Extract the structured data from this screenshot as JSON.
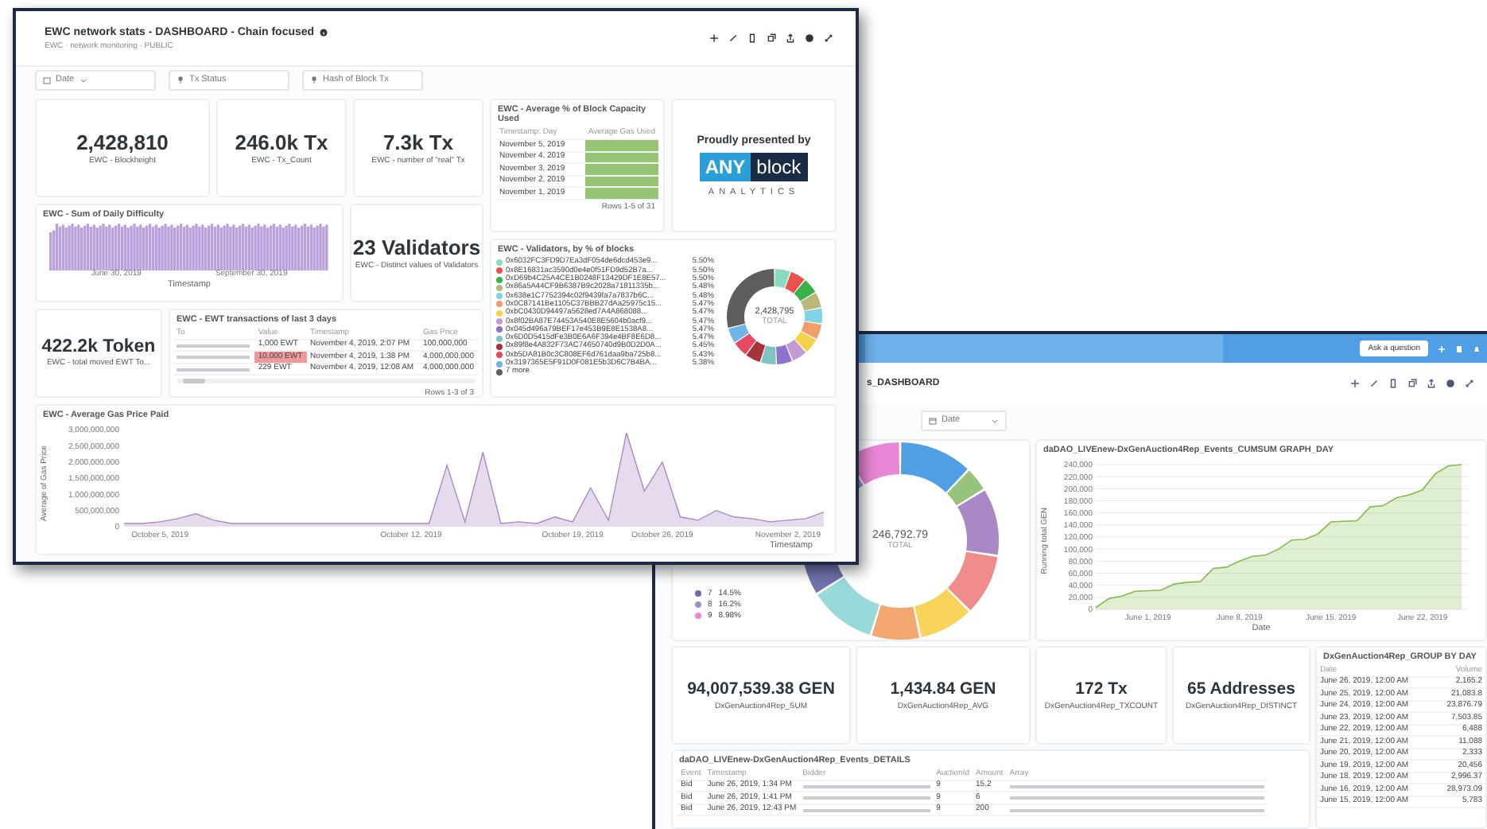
{
  "front_dashboard": {
    "title": "EWC network stats - DASHBOARD - Chain focused",
    "subtitle": "EWC · network monitoring · PUBLIC",
    "filters": [
      "Date",
      "Tx Status",
      "Hash of Block Tx"
    ],
    "stats": [
      {
        "value": "2,428,810",
        "label": "EWC - Blockheight"
      },
      {
        "value": "246.0k Tx",
        "label": "EWC - Tx_Count"
      },
      {
        "value": "7.3k Tx",
        "label": "EWC - number of \"real\" Tx"
      }
    ],
    "capacity_table": {
      "title": "EWC - Average % of Block Capacity Used",
      "columns": [
        "Timestamp: Day",
        "Average Gas Used"
      ],
      "rows": [
        "November 5, 2019",
        "November 4, 2019",
        "November 3, 2019",
        "November 2, 2019",
        "November 1, 2019"
      ],
      "footer": "Rows 1-5 of 31"
    },
    "promo": {
      "heading": "Proudly presented by",
      "logo_left": "ANY",
      "logo_right": "block",
      "logo_sub": "ANALYTICS"
    },
    "difficulty_chart": {
      "title": "EWC - Sum of Daily Difficulty",
      "x_labels": [
        "June 30, 2019",
        "September 30, 2019"
      ],
      "xlabel": "Timestamp"
    },
    "validators_stat": {
      "value": "23 Validators",
      "label": "EWC - Distinct values of Validators"
    },
    "validators_donut": {
      "title": "EWC - Validators, by % of blocks",
      "center_value": "2,428,795",
      "center_label": "TOTAL",
      "chart_data": {
        "type": "donut",
        "legend": "left",
        "categories": [
          "0x6032FC3FD9D7Ea3dF054de6dcd453e9...",
          "0x8E16831ac3590d0e4e0f51FD9d52B7a...",
          "0xD69b4C25A4CE1B0248F13429DF1E8E57...",
          "0x86a5A44CF9B6387B9c2028a71811335b...",
          "0x638e1C7752394c02f9439fa7a7837b6C...",
          "0x0C87141Be1105C37BBB27dAa25975c15...",
          "0xbC0430D94497a5628ed7A4A868088...",
          "0x8f02BA87E74453A540E8E5604b0acf9...",
          "0x045d496a79BEF17e453B9E8E1538A8...",
          "0x6D0D5415dFe3B0E6A6F394e4BF8E6D8...",
          "0x89f8e4A832F73AC74650740d9B0D2D0A...",
          "0xb5DA81B0c3C808EF6d761daa9ba725b8...",
          "0x3197365E5F91D0F081E5b3D6C7B4BA...",
          "7 more"
        ],
        "values": [
          5.5,
          5.5,
          5.5,
          5.48,
          5.48,
          5.47,
          5.47,
          5.47,
          5.47,
          5.47,
          5.45,
          5.43,
          5.38,
          28.93
        ],
        "value_labels": [
          "5.50%",
          "5.50%",
          "5.50%",
          "5.48%",
          "5.48%",
          "5.47%",
          "5.47%",
          "5.47%",
          "5.47%",
          "5.47%",
          "5.45%",
          "5.43%",
          "5.38%",
          null
        ],
        "colors": [
          "#88dbc2",
          "#e9524f",
          "#37b24d",
          "#b9b878",
          "#81d4e3",
          "#f29e6b",
          "#f5d24b",
          "#c49bd3",
          "#8f72c9",
          "#7fc4c0",
          "#a8323a",
          "#e54a62",
          "#6fb6e8",
          "#5e5e5e"
        ]
      }
    },
    "token_stat": {
      "value": "422.2k Token",
      "label": "EWC - total moved EWT To..."
    },
    "tx_table": {
      "title": "EWC - EWT transactions of last 3 days",
      "columns": [
        "To",
        "Value",
        "Timestamp",
        "Gas Price"
      ],
      "rows": [
        {
          "value": "1,000 EWT",
          "highlighted": false,
          "time": "November 4, 2019, 2:07 PM",
          "gas": "100,000,000"
        },
        {
          "value": "10,000 EWT",
          "highlighted": true,
          "time": "November 4, 2019, 1:38 PM",
          "gas": "4,000,000,000"
        },
        {
          "value": "229 EWT",
          "highlighted": false,
          "time": "November 4, 2019, 12:08 AM",
          "gas": "4,000,000,000"
        }
      ]
    },
    "gas_chart": {
      "title": "EWC - Average Gas Price Paid",
      "chart_data": {
        "type": "area",
        "xlabel": "Timestamp",
        "ylabel": "Average of Gas Price",
        "categories": [
          null,
          null,
          "October 5, 2019",
          null,
          null,
          null,
          null,
          null,
          null,
          null,
          null,
          null,
          null,
          null,
          null,
          null,
          "October 12, 2019",
          null,
          null,
          null,
          null,
          null,
          null,
          null,
          null,
          "October 19, 2019",
          null,
          null,
          null,
          null,
          "October 26, 2019",
          null,
          null,
          null,
          null,
          null,
          null,
          "November 2, 2019",
          null,
          null
        ],
        "series": [
          {
            "color": "#a989c5",
            "values": [
              100000000,
              100000000,
              150000000,
              250000000,
              400000000,
              200000000,
              100000000,
              100000000,
              100000000,
              100000000,
              100000000,
              100000000,
              100000000,
              100000000,
              100000000,
              100000000,
              100000000,
              100000000,
              1900000000,
              150000000,
              2300000000,
              100000000,
              150000000,
              100000000,
              300000000,
              150000000,
              1200000000,
              200000000,
              2900000000,
              1100000000,
              2000000000,
              300000000,
              200000000,
              500000000,
              300000000,
              250000000,
              150000000,
              200000000,
              250000000,
              450000000
            ]
          }
        ],
        "ylim": [
          0,
          3000000000
        ],
        "yticks": [
          {
            "value": 0,
            "label": "0"
          },
          {
            "value": 500000000,
            "label": "500,000,000"
          },
          {
            "value": 1000000000,
            "label": "1,000,000,000"
          },
          {
            "value": 1500000000,
            "label": "1,500,000,000"
          },
          {
            "value": 2000000000,
            "label": "2,000,000,000"
          },
          {
            "value": 2500000000,
            "label": "2,500,000,000"
          },
          {
            "value": 3000000000,
            "label": "3,000,000,000"
          }
        ]
      }
    },
    "tx_footer": "Rows 1-3 of 3"
  },
  "back_dashboard": {
    "ask_button": "Ask a question",
    "title": "s_DASHBOARD",
    "filters": [
      "Date"
    ],
    "donut": {
      "center_value": "246,792.79",
      "center_label": "TOTAL",
      "legend": [
        {
          "label": "7",
          "percent": "14.5%",
          "color": "#6a6aa8"
        },
        {
          "label": "8",
          "percent": "16.2%",
          "color": "#8e98c8"
        },
        {
          "label": "9",
          "percent": "8.98%",
          "color": "#e887d6"
        }
      ]
    },
    "cumsum_chart": {
      "title": "daDAO_LIVEnew-DxGenAuction4Rep_Events_CUMSUM GRAPH_DAY",
      "chart_data": {
        "type": "area",
        "grid": true,
        "xlabel": "Date",
        "ylabel": "Running total GEN",
        "categories": [
          null,
          null,
          null,
          null,
          "June 1, 2019",
          null,
          null,
          null,
          null,
          null,
          null,
          "June 8, 2019",
          null,
          null,
          null,
          null,
          null,
          null,
          "June 15, 2019",
          null,
          null,
          null,
          null,
          null,
          null,
          "June 22, 2019",
          null,
          null,
          null
        ],
        "series": [
          {
            "color": "#84bb4c",
            "values": [
              3000,
              18000,
              22000,
              30000,
              31000,
              32000,
              42000,
              45000,
              46000,
              68000,
              70000,
              80000,
              88000,
              90000,
              100000,
              115000,
              116000,
              125000,
              145000,
              146000,
              147000,
              170000,
              172000,
              185000,
              190000,
              198000,
              225000,
              238000,
              240000
            ]
          }
        ],
        "ylim": [
          0,
          240000
        ],
        "yticks": [
          {
            "value": 0,
            "label": "0"
          },
          {
            "value": 20000,
            "label": "20,000"
          },
          {
            "value": 40000,
            "label": "40,000"
          },
          {
            "value": 60000,
            "label": "60,000"
          },
          {
            "value": 80000,
            "label": "80,000"
          },
          {
            "value": 100000,
            "label": "100,000"
          },
          {
            "value": 120000,
            "label": "120,000"
          },
          {
            "value": 140000,
            "label": "140,000"
          },
          {
            "value": 160000,
            "label": "160,000"
          },
          {
            "value": 180000,
            "label": "180,000"
          },
          {
            "value": 200000,
            "label": "200,000"
          },
          {
            "value": 220000,
            "label": "220,000"
          },
          {
            "value": 240000,
            "label": "240,000"
          }
        ]
      }
    },
    "stats": [
      {
        "value": "94,007,539.38 GEN",
        "label": "DxGenAuction4Rep_SUM"
      },
      {
        "value": "1,434.84 GEN",
        "label": "DxGenAuction4Rep_AVG"
      },
      {
        "value": "172 Tx",
        "label": "DxGenAuction4Rep_TXCOUNT"
      },
      {
        "value": "65 Addresses",
        "label": "DxGenAuction4Rep_DISTINCT"
      }
    ],
    "details_table": {
      "title": "daDAO_LIVEnew-DxGenAuction4Rep_Events_DETAILS",
      "columns": [
        "Event",
        "Timestamp",
        "Bidder",
        "AuctionId",
        "Amount",
        "Array"
      ],
      "rows": [
        {
          "event": "Bid",
          "time": "June 26, 2019, 1:34 PM",
          "auction": "9",
          "amount": "15.2"
        },
        {
          "event": "Bid",
          "time": "June 26, 2019, 1:41 PM",
          "auction": "9",
          "amount": "6"
        },
        {
          "event": "Bid",
          "time": "June 26, 2019, 12:43 PM",
          "auction": "9",
          "amount": "200"
        }
      ]
    },
    "day_table": {
      "title": "DxGenAuction4Rep_GROUP BY DAY",
      "columns": [
        "Date",
        "Volume"
      ],
      "rows": [
        [
          "June 26, 2019, 12:00 AM",
          "2,165.2"
        ],
        [
          "June 25, 2019, 12:00 AM",
          "21,083.8"
        ],
        [
          "June 24, 2019, 12:00 AM",
          "23,876.79"
        ],
        [
          "June 23, 2019, 12:00 AM",
          "7,503.85"
        ],
        [
          "June 22, 2019, 12:00 AM",
          "6,488"
        ],
        [
          "June 21, 2019, 12:00 AM",
          "11,088"
        ],
        [
          "June 20, 2019, 12:00 AM",
          "2,333"
        ],
        [
          "June 19, 2019, 12:00 AM",
          "20,456"
        ],
        [
          "June 18, 2019, 12:00 AM",
          "2,996.37"
        ],
        [
          "June 16, 2019, 12:00 AM",
          "28,973.09"
        ],
        [
          "June 15, 2019, 12:00 AM",
          "5,783"
        ]
      ]
    }
  }
}
